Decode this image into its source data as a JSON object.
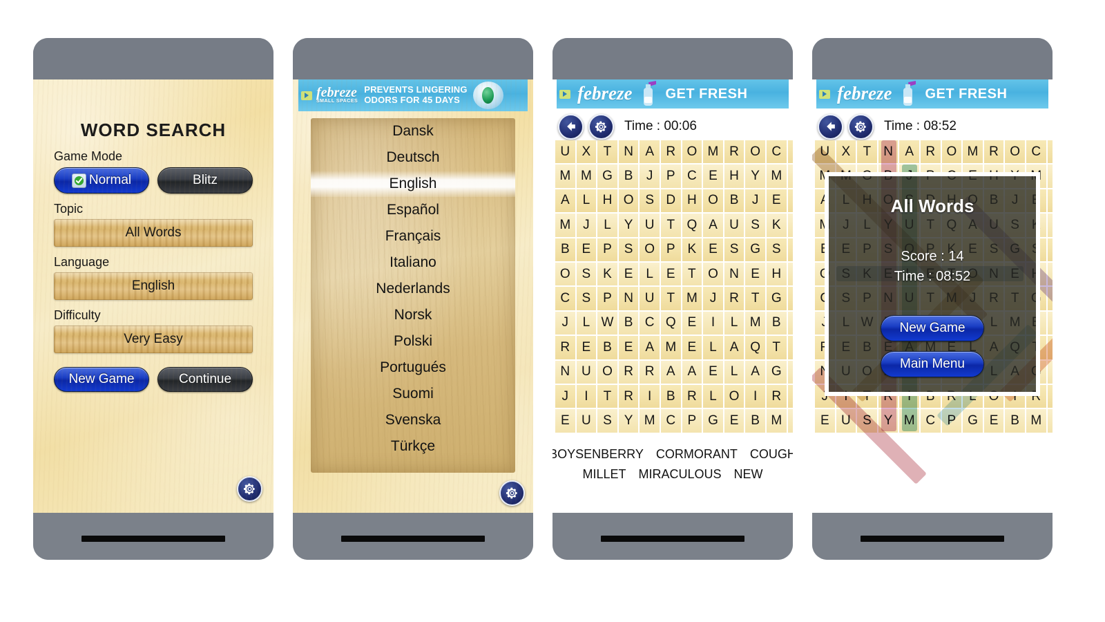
{
  "app": {
    "name": "Word Search"
  },
  "phones": [
    {
      "id": "main-menu",
      "screen": {
        "title": "WORD SEARCH",
        "game_mode": {
          "label": "Game Mode",
          "options": [
            {
              "label": "Normal",
              "selected": true,
              "style": "blue"
            },
            {
              "label": "Blitz",
              "selected": false,
              "style": "dark"
            }
          ]
        },
        "topic": {
          "label": "Topic",
          "value": "All Words"
        },
        "language": {
          "label": "Language",
          "value": "English"
        },
        "difficulty": {
          "label": "Difficulty",
          "value": "Very Easy"
        },
        "actions": [
          {
            "label": "New Game",
            "style": "blue"
          },
          {
            "label": "Continue",
            "style": "dark"
          }
        ],
        "settings_icon": "gear-icon"
      }
    },
    {
      "id": "language-picker",
      "ad": {
        "brand": "febreze",
        "brand_sub": "SMALL SPACES",
        "line1": "PREVENTS LINGERING",
        "line2": "ODORS FOR 45 DAYS",
        "variant": "wide"
      },
      "languages": [
        "Dansk",
        "Deutsch",
        "English",
        "Español",
        "Français",
        "Italiano",
        "Nederlands",
        "Norsk",
        "Polski",
        "Portugués",
        "Suomi",
        "Svenska",
        "Türkçe"
      ],
      "selected_language": "English",
      "settings_icon": "gear-icon"
    },
    {
      "id": "game-board",
      "ad": {
        "brand": "febreze",
        "tagline": "GET FRESH",
        "variant": "compact"
      },
      "header": {
        "back_icon": "back-arrow-icon",
        "settings_icon": "gear-icon",
        "time": "Time : 00:06"
      },
      "grid": {
        "rows": 13,
        "cols": 12,
        "letters": [
          "UXTNAROMROC",
          "MMGBJPCEHYM",
          "ALHOSDHOBJE",
          "MJLYUTQAUSK",
          "BEPSOPKESGS",
          "OSKELETONEH",
          "CSPNUTMJRTG",
          "JLWBCQEILMB",
          "REBEAMELAQT",
          "NUORRAAELAG",
          "JITRIBRLOIR",
          "EUSYMCPGEBM"
        ]
      },
      "words": [
        "BOYSENBERRY",
        "CORMORANT",
        "COUGH",
        "MILLET",
        "MIRACULOUS",
        "NEW"
      ]
    },
    {
      "id": "game-over-dialog",
      "ad": {
        "brand": "febreze",
        "tagline": "GET FRESH",
        "variant": "compact"
      },
      "header": {
        "back_icon": "back-arrow-icon",
        "settings_icon": "gear-icon",
        "time": "Time : 08:52"
      },
      "dialog": {
        "title": "All Words",
        "score": "Score : 14",
        "time": "Time : 08:52",
        "buttons": [
          {
            "label": "New Game",
            "style": "blue"
          },
          {
            "label": "Main Menu",
            "style": "blue"
          }
        ]
      }
    }
  ],
  "colors": {
    "phone_bezel": "#767c86",
    "paper": "#f3dfa4",
    "accent_blue": "#1a3ec4",
    "dark_button": "#3b3f46",
    "ad_blue": "#49b2e0",
    "tile": "#f3e2a9"
  }
}
